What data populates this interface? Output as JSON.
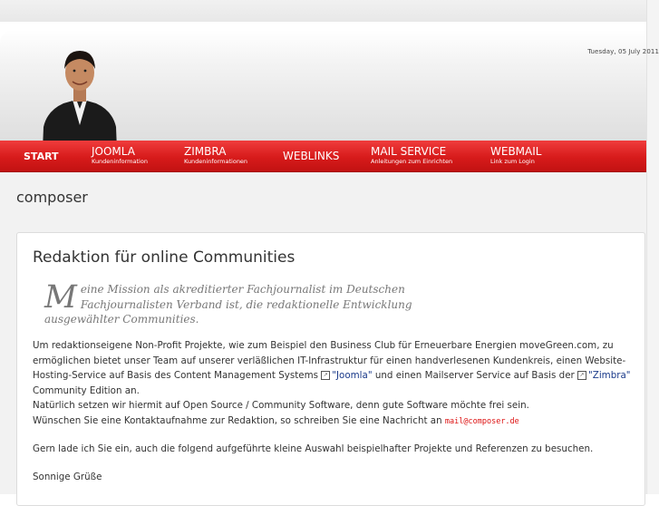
{
  "header": {
    "date": "Tuesday, 05 July 2011"
  },
  "nav": {
    "start": "START",
    "items": [
      {
        "label": "JOOMLA",
        "sub": "Kundeninformation"
      },
      {
        "label": "ZIMBRA",
        "sub": "Kundeninformationen"
      },
      {
        "label": "WEBLINKS",
        "sub": ""
      },
      {
        "label": "MAIL SERVICE",
        "sub": "Anleitungen zum Einrichten"
      },
      {
        "label": "WEBMAIL",
        "sub": "Link zum Login"
      }
    ]
  },
  "page": {
    "title": "composer"
  },
  "article": {
    "title": "Redaktion für online Communities",
    "quote_initial": "M",
    "quote_line1": "eine Mission als akreditierter Fachjournalist im Deutschen",
    "quote_line2": "Fachjournalisten Verband ist, die redaktionelle Entwicklung",
    "quote_line3": "ausgewählter Communities.",
    "p1_a": "Um redaktionseigene Non-Profit Projekte, wie zum Beispiel den Business Club für Erneuerbare Energien moveGreen.com, zu ermöglichen bietet unser Team auf unserer verläßlichen IT-Infrastruktur für einen handverlesenen Kundenkreis, einen Website-Hosting-Service auf Basis des Content Management Systems ",
    "p1_link1": "\"Joomla\"",
    "p1_b": " und einen Mailserver Service auf Basis der ",
    "p1_link2": "\"Zimbra\"",
    "p1_c": " Community Edition an.",
    "p2": "Natürlich setzen wir hiermit auf Open Source / Community Software, denn gute Software möchte frei sein.",
    "p3": "Wünschen Sie eine Kontaktaufnahme zur Redaktion, so schreiben Sie eine Nachricht an ",
    "email": "mail@composer.de",
    "p4": "Gern lade ich Sie ein, auch die folgend aufgeführte kleine Auswahl beispielhafter Projekte und Referenzen zu besuchen.",
    "p5": "Sonnige Grüße"
  },
  "icons": {
    "external_link": "external-link-icon"
  },
  "colors": {
    "nav_red": "#d71b1b",
    "link_blue": "#1a3a8a",
    "email_red": "#dd1111"
  }
}
